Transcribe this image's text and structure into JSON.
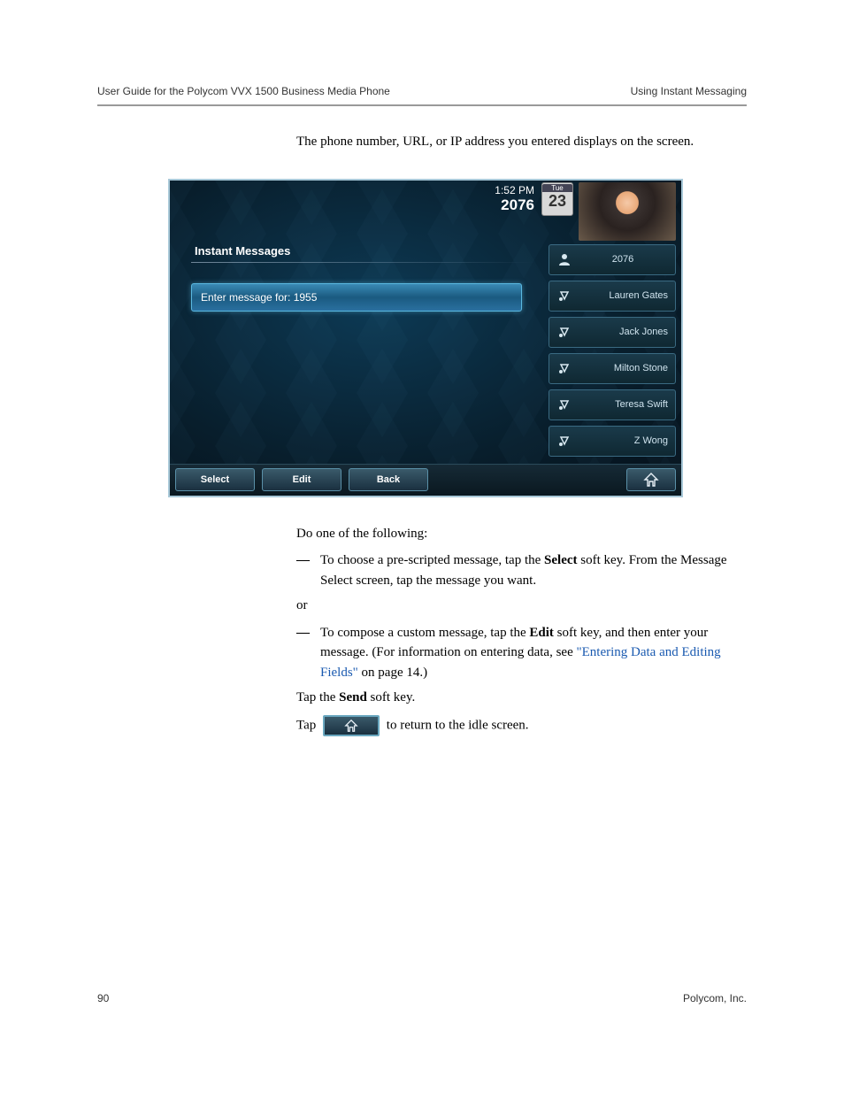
{
  "header": {
    "left": "User Guide for the Polycom VVX 1500 Business Media Phone",
    "right": "Using Instant Messaging"
  },
  "intro": "The phone number, URL, or IP address you entered displays on the screen.",
  "phone": {
    "time": "1:52 PM",
    "extension": "2076",
    "date_dow": "Tue",
    "date_day": "23",
    "screen_title": "Instant Messages",
    "input_label": "Enter message for: 1955",
    "line_keys": [
      {
        "label": "2076",
        "type": "extension"
      },
      {
        "label": "Lauren Gates",
        "type": "contact"
      },
      {
        "label": "Jack Jones",
        "type": "contact"
      },
      {
        "label": "Milton Stone",
        "type": "contact"
      },
      {
        "label": "Teresa Swift",
        "type": "contact"
      },
      {
        "label": "Z Wong",
        "type": "contact"
      }
    ],
    "softkeys": [
      "Select",
      "Edit",
      "Back"
    ]
  },
  "body": {
    "lead": "Do one of the following:",
    "bullet1_pre": "To choose a pre-scripted message, tap the ",
    "bullet1_bold": "Select",
    "bullet1_post": " soft key. From the Message Select screen, tap the message you want.",
    "or": "or",
    "bullet2_pre": "To compose a custom message, tap the ",
    "bullet2_bold": "Edit",
    "bullet2_mid": " soft key, and then enter your message. (For information on entering data, see ",
    "link_text": "\"Entering Data and Editing Fields\"",
    "bullet2_post": " on page 14.)",
    "send_pre": "Tap the ",
    "send_bold": "Send",
    "send_post": " soft key.",
    "return_pre": "Tap ",
    "return_post": " to return to the idle screen."
  },
  "footer": {
    "page_number": "90",
    "company": "Polycom, Inc."
  }
}
